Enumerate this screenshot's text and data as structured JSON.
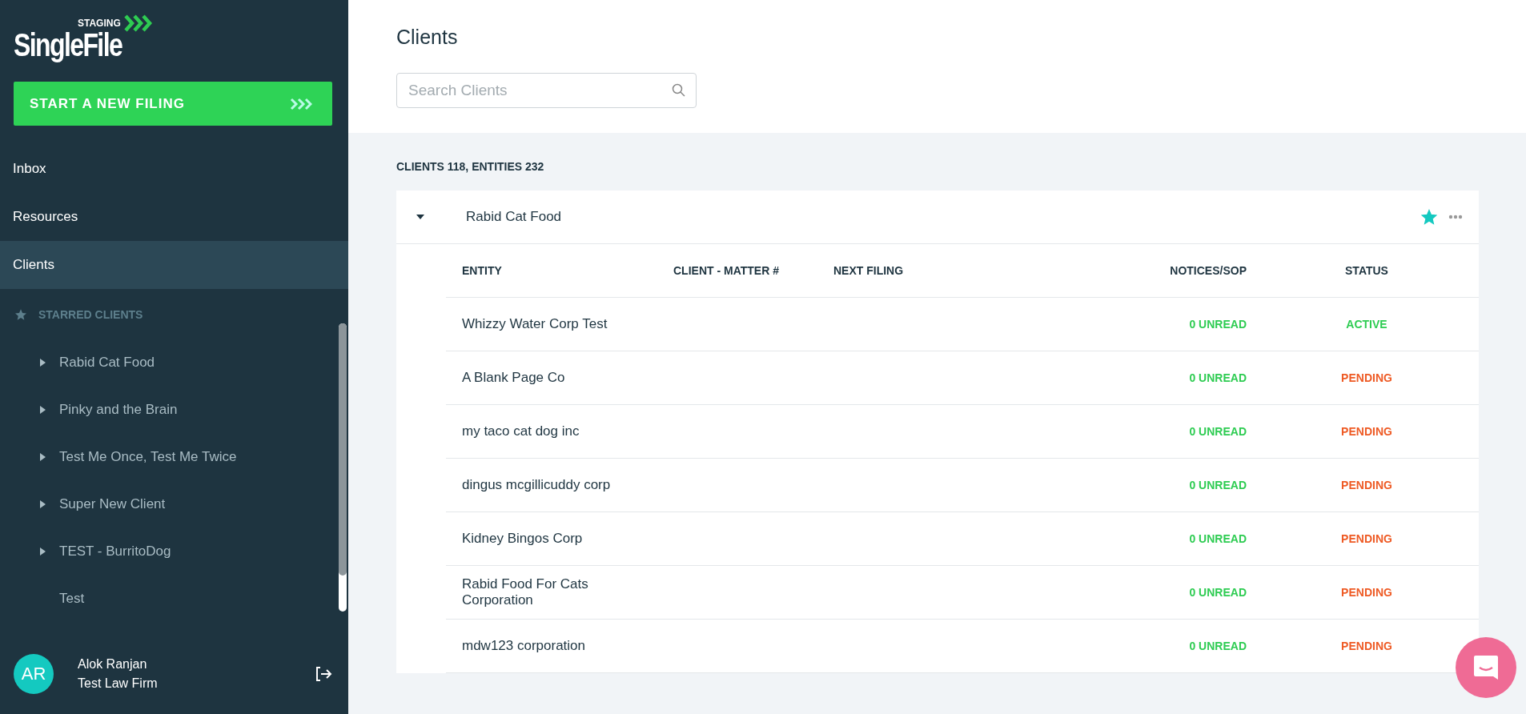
{
  "sidebar": {
    "logo": {
      "badge": "STAGING",
      "name": "SingleFile"
    },
    "new_filing_button": "START A NEW FILING",
    "nav": [
      {
        "label": "Inbox",
        "selected": false
      },
      {
        "label": "Resources",
        "selected": false
      },
      {
        "label": "Clients",
        "selected": true
      }
    ],
    "starred_header": "STARRED CLIENTS",
    "starred_clients": [
      {
        "label": "Rabid Cat Food",
        "kind": "group"
      },
      {
        "label": "Pinky and the Brain",
        "kind": "group"
      },
      {
        "label": "Test Me Once, Test Me Twice",
        "kind": "group"
      },
      {
        "label": "Super New Client",
        "kind": "group"
      },
      {
        "label": "TEST - BurritoDog",
        "kind": "group"
      },
      {
        "label": "Test",
        "kind": "leaf"
      }
    ],
    "user": {
      "initials": "AR",
      "name": "Alok Ranjan",
      "firm": "Test Law Firm"
    }
  },
  "page": {
    "title": "Clients",
    "search": {
      "placeholder": "Search Clients"
    },
    "summary": "CLIENTS 118, ENTITIES 232"
  },
  "client": {
    "name": "Rabid Cat Food",
    "expanded": true,
    "starred": true,
    "table": {
      "columns": [
        "ENTITY",
        "CLIENT - MATTER #",
        "NEXT FILING",
        "NOTICES/SOP",
        "STATUS"
      ],
      "rows": [
        {
          "entity": "Whizzy Water Corp Test",
          "notices": "0 UNREAD",
          "status": "ACTIVE",
          "color": "#2ecc52"
        },
        {
          "entity": "A Blank Page Co",
          "notices": "0 UNREAD",
          "status": "PENDING",
          "color": "#ee5a24"
        },
        {
          "entity": "my taco cat dog inc",
          "notices": "0 UNREAD",
          "status": "PENDING",
          "color": "#ee5a24"
        },
        {
          "entity": "dingus mcgillicuddy corp",
          "notices": "0 UNREAD",
          "status": "PENDING",
          "color": "#ee5a24"
        },
        {
          "entity": "Kidney Bingos Corp",
          "notices": "0 UNREAD",
          "status": "PENDING",
          "color": "#ee5a24"
        },
        {
          "entity": "Rabid Food For Cats Corporation",
          "notices": "0 UNREAD",
          "status": "PENDING",
          "color": "#ee5a24"
        },
        {
          "entity": "mdw123 corporation",
          "notices": "0 UNREAD",
          "status": "PENDING",
          "color": "#ee5a24"
        }
      ]
    }
  }
}
